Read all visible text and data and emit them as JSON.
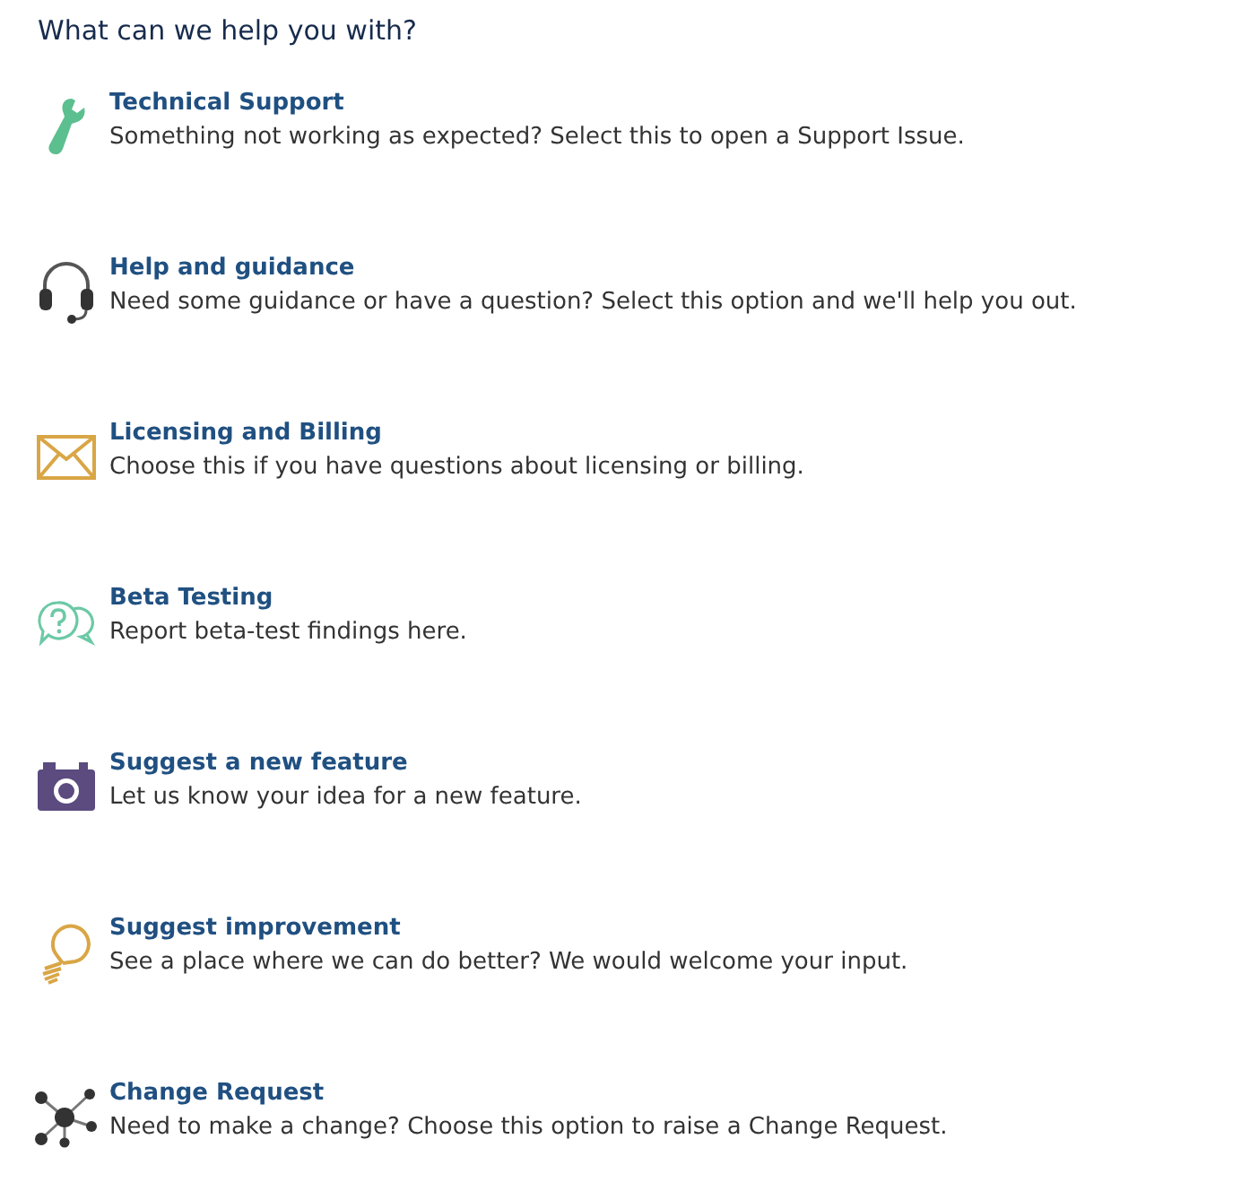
{
  "heading": "What can we help you with?",
  "options": [
    {
      "kind": "wrench",
      "title": "Technical Support",
      "description": "Something not working as expected? Select this to open a Support Issue."
    },
    {
      "kind": "headset",
      "title": "Help and guidance",
      "description": "Need some guidance or have a question? Select this option and we'll help you out."
    },
    {
      "kind": "envelope",
      "title": "Licensing and Billing",
      "description": "Choose this if you have questions about licensing or billing."
    },
    {
      "kind": "chat",
      "title": "Beta Testing",
      "description": "Report beta-test findings here."
    },
    {
      "kind": "camera",
      "title": "Suggest a new feature",
      "description": "Let us know your idea for a new feature."
    },
    {
      "kind": "bulb",
      "title": "Suggest improvement",
      "description": "See a place where we can do better? We would welcome your input."
    },
    {
      "kind": "network",
      "title": "Change Request",
      "description": "Need to make a change? Choose this option to raise a Change Request."
    }
  ]
}
